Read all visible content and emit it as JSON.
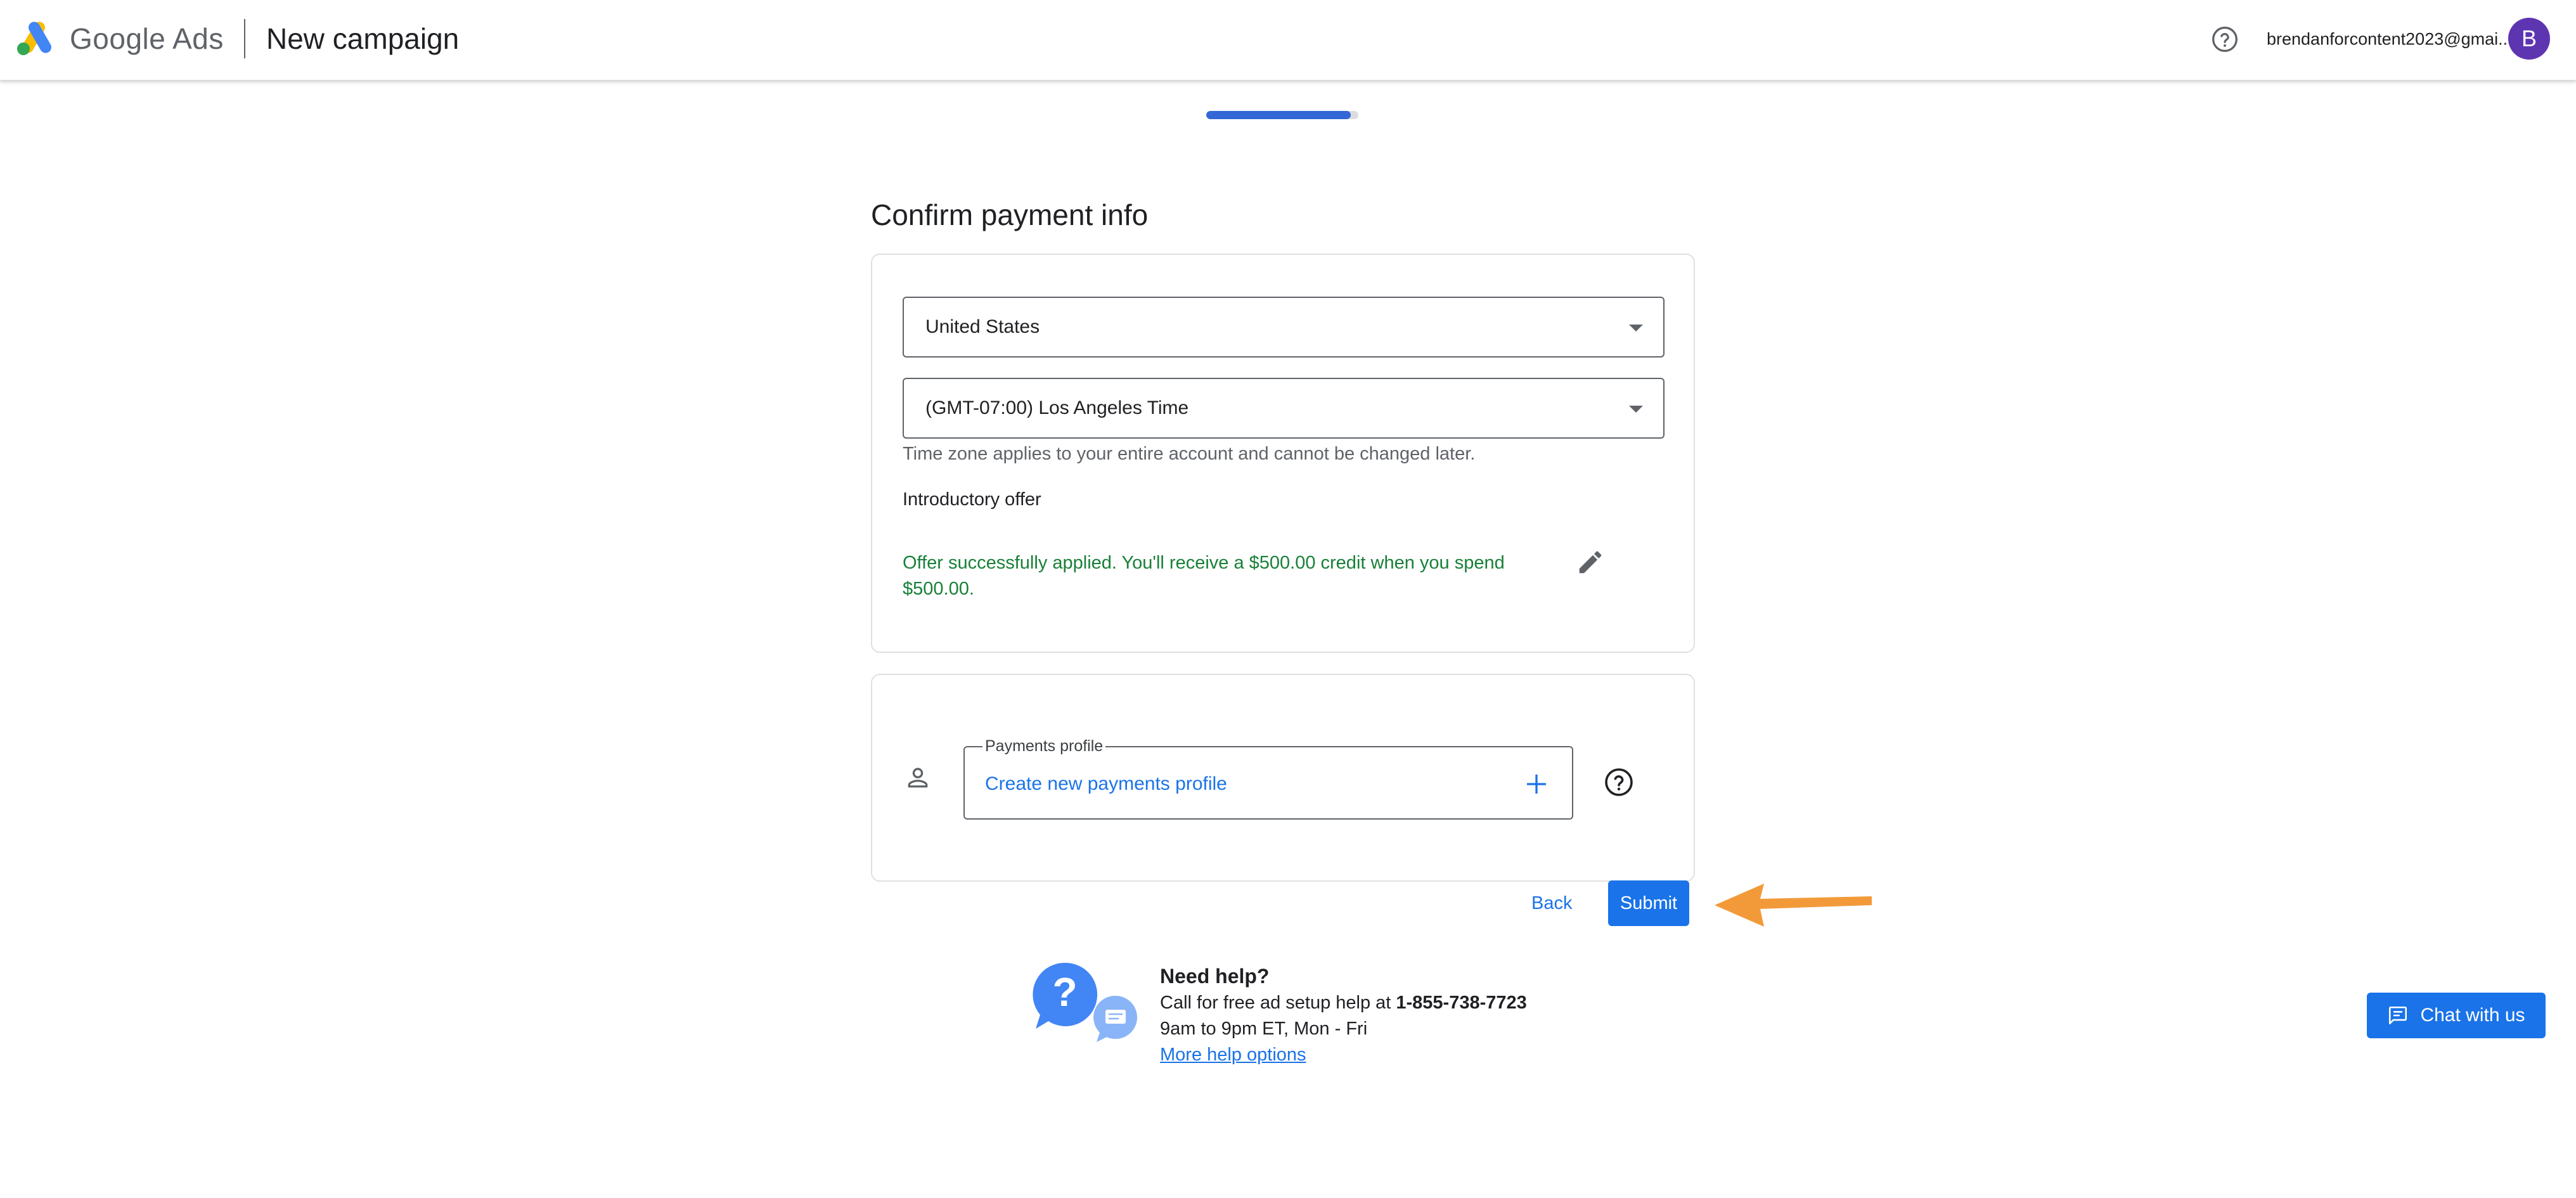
{
  "header": {
    "brand_first": "Google",
    "brand_second": "Ads",
    "title": "New campaign",
    "account_email": "brendanforcontent2023@gmai...",
    "avatar_initial": "B"
  },
  "progress": {
    "fraction": 0.95
  },
  "page_title": "Confirm payment info",
  "billing": {
    "country": "United States",
    "time_zone": "(GMT-07:00) Los Angeles Time",
    "time_zone_hint": "Time zone applies to your entire account and cannot be changed later.",
    "intro_offer_label": "Introductory offer",
    "intro_offer_status": "Offer successfully applied. You'll receive a $500.00 credit when you spend $500.00."
  },
  "payments": {
    "legend": "Payments profile",
    "value": "Create new payments profile"
  },
  "actions": {
    "back_label": "Back",
    "submit_label": "Submit"
  },
  "help": {
    "title": "Need help?",
    "call_prefix": "Call for free ad setup help at ",
    "phone": "1-855-738-7723",
    "hours": "9am to 9pm ET, Mon - Fri",
    "more_link": "More help options"
  },
  "chat": {
    "label": "Chat with us"
  },
  "colors": {
    "accent": "#1a73e8",
    "success_text": "#188038",
    "avatar_bg": "#5e35b1",
    "annotation_arrow": "#f29a3a"
  },
  "icons": {
    "logo": "google-ads-logo",
    "help": "help-circle-icon",
    "caret": "caret-down-icon",
    "edit": "pencil-icon",
    "person": "person-icon",
    "plus": "plus-icon",
    "chat": "chat-bubble-icon"
  }
}
